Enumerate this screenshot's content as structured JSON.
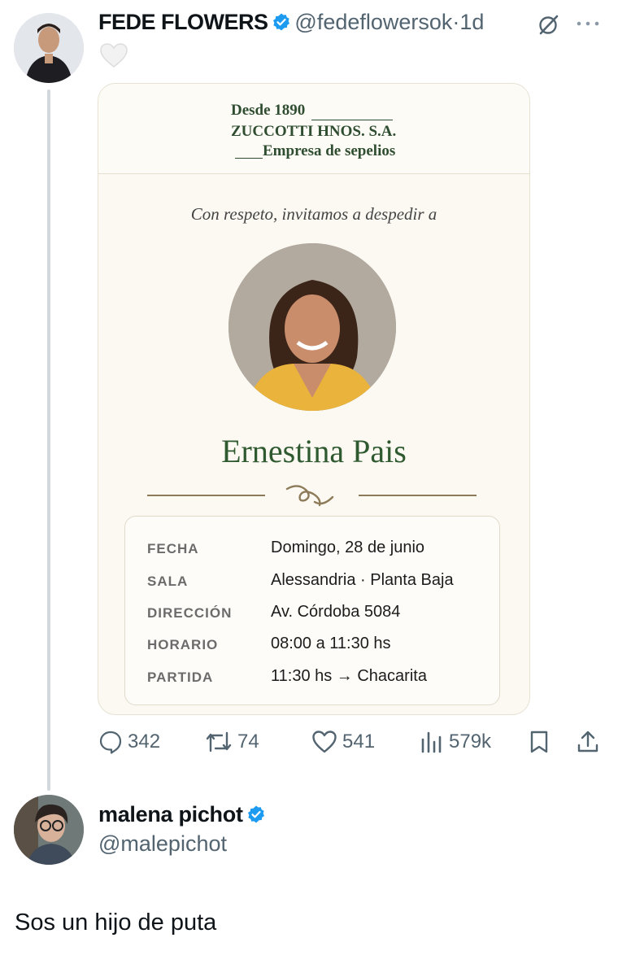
{
  "tweet": {
    "author_name": "FEDE FLOWERS",
    "author_handle": "@fedeflowersok",
    "separator": "·",
    "time": "1d",
    "icons": [
      "verified-icon",
      "grok-icon",
      "more-icon",
      "heart-icon"
    ]
  },
  "card": {
    "header": {
      "line1": "Desde 1890",
      "line2": "ZUCCOTTI HNOS. S.A.",
      "line3": "Empresa de sepelios"
    },
    "invite_text": "Con respeto, invitamos a despedir a",
    "deceased_name": "Ernestina Pais",
    "details": [
      {
        "label": "FECHA",
        "value": "Domingo, 28 de junio"
      },
      {
        "label": "SALA",
        "value": "Alessandria · Planta Baja"
      },
      {
        "label": "DIRECCIÓN",
        "value": "Av. Córdoba 5084"
      },
      {
        "label": "HORARIO",
        "value": "08:00 a 11:30 hs"
      },
      {
        "label": "PARTIDA",
        "value": "11:30 hs → Chacarita"
      }
    ],
    "colors": {
      "accent_green": "#2f5a30",
      "ornament": "#8d7a58",
      "background": "#fbf9f2"
    }
  },
  "actions": {
    "replies": "342",
    "reposts": "74",
    "likes": "541",
    "views": "579k"
  },
  "reply": {
    "author_name": "malena pichot",
    "author_handle": "@malepichot",
    "text": "Sos un hijo de puta"
  },
  "colors": {
    "verified_blue": "#1d9bf0",
    "muted": "#536471"
  }
}
